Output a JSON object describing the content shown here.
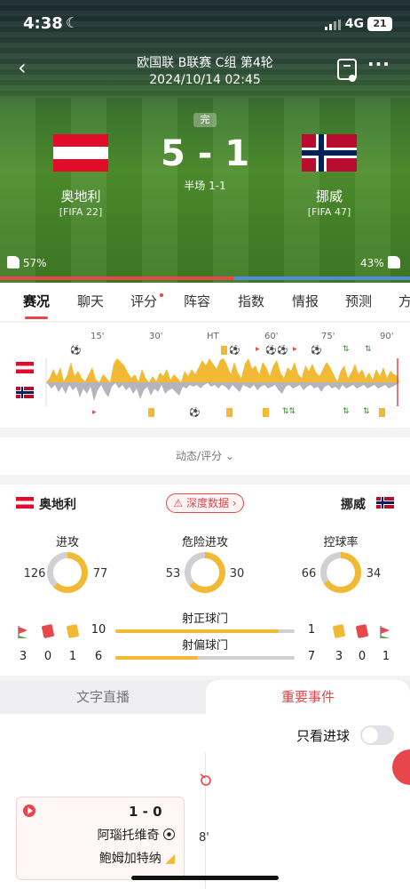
{
  "status_bar": {
    "time": "4:38",
    "network": "4G",
    "battery": "21"
  },
  "header": {
    "title": "欧国联 B联赛 C组 第4轮",
    "datetime": "2024/10/14 02:45",
    "state": "完",
    "score": "5 - 1",
    "halftime": "半场 1-1"
  },
  "home": {
    "name": "奥地利",
    "rank": "[FIFA 22]",
    "support": "57%",
    "flag_colors": [
      "#e30b2a",
      "#ffffff"
    ]
  },
  "away": {
    "name": "挪威",
    "rank": "[FIFA 47]",
    "support": "43%",
    "flag_colors": [
      "#ba0c2f",
      "#ffffff",
      "#00205b"
    ]
  },
  "support_fraction_home": 0.57,
  "tabs": [
    "赛况",
    "聊天",
    "评分",
    "阵容",
    "指数",
    "情报",
    "预测",
    "方"
  ],
  "timeline": {
    "ticks": [
      "15'",
      "30'",
      "HT",
      "60'",
      "75'",
      "90'"
    ]
  },
  "dynamic_link": "动态/评分 ⌄",
  "stats": {
    "home_name": "奥地利",
    "away_name": "挪威",
    "deep_data": "⚠ 深度数据 ›",
    "metrics": [
      {
        "label": "进攻",
        "home": "126",
        "away": "77"
      },
      {
        "label": "危险进攻",
        "home": "53",
        "away": "30"
      },
      {
        "label": "控球率",
        "home": "66",
        "away": "34"
      }
    ],
    "shots_on": {
      "label": "射正球门",
      "home": "10",
      "away": "1",
      "fraction_home": 0.91
    },
    "shots_off": {
      "label": "射偏球门",
      "home": "6",
      "away": "7",
      "fraction_home": 0.46
    },
    "home_counts": [
      "3",
      "0",
      "1"
    ],
    "away_counts": [
      "3",
      "0",
      "1"
    ],
    "colors": {
      "accent": "#e7464a",
      "yellow": "#f2b935",
      "grey": "#cfcfd4"
    }
  },
  "events": {
    "tab_live": "文字直播",
    "tab_key": "重要事件",
    "goals_only": "只看进球",
    "card": {
      "score": "1 - 0",
      "scorer": "阿瑙托维奇",
      "assist": "鲍姆加特纳",
      "minute": "8'"
    }
  }
}
